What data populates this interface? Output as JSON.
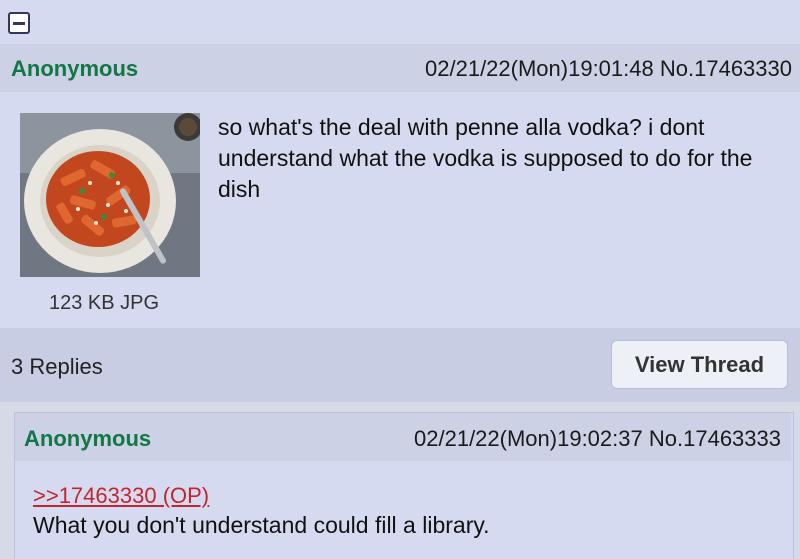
{
  "op": {
    "name": "Anonymous",
    "datetime": "02/21/22(Mon)19:01:48",
    "post_number": "No.17463330",
    "file_info": "123 KB JPG",
    "thumbnail": "penne-pasta-image",
    "comment": "so what's the deal with penne alla vodka? i dont understand what the vodka is supposed to do for the dish"
  },
  "thread_footer": {
    "replies": "3 Replies",
    "view_thread_label": "View Thread"
  },
  "reply": {
    "name": "Anonymous",
    "datetime": "02/21/22(Mon)19:02:37",
    "post_number": "No.17463333",
    "quote_link": ">>17463330 (OP)",
    "comment": "What you don't understand could fill a library."
  },
  "colors": {
    "post_bg": "#d6daf0",
    "header_bg": "#ccd1e6",
    "name": "#117743",
    "quote_link": "#c0272d"
  },
  "icons": {
    "collapse": "minus-square-icon"
  }
}
